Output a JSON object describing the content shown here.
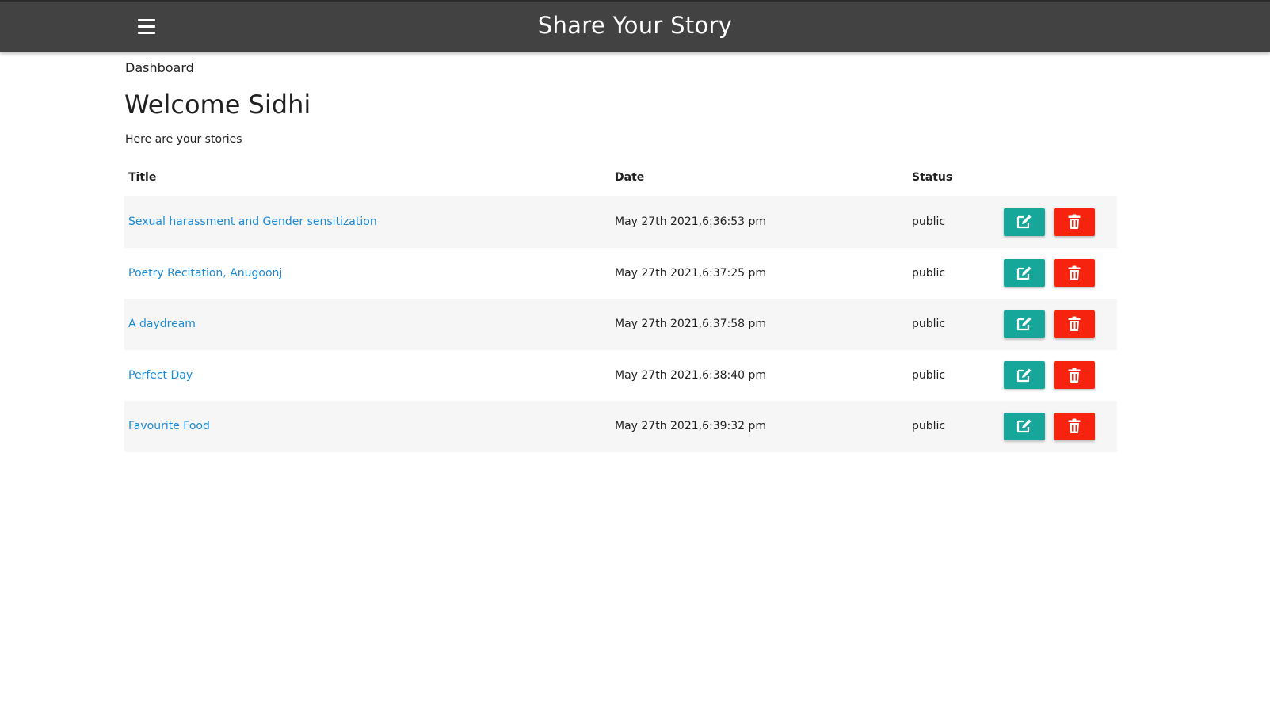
{
  "header": {
    "app_title": "Share Your Story",
    "menu_icon": "hamburger-menu-icon",
    "bar_color": "#424242"
  },
  "page": {
    "breadcrumb": "Dashboard",
    "welcome": "Welcome Sidhi",
    "subtitle": "Here are your stories"
  },
  "table": {
    "columns": [
      "Title",
      "Date",
      "Status"
    ],
    "rows": [
      {
        "title": "Sexual harassment and Gender sensitization",
        "date": "May 27th 2021,6:36:53 pm",
        "status": "public"
      },
      {
        "title": "Poetry Recitation, Anugoonj",
        "date": "May 27th 2021,6:37:25 pm",
        "status": "public"
      },
      {
        "title": "A daydream",
        "date": "May 27th 2021,6:37:58 pm",
        "status": "public"
      },
      {
        "title": "Perfect Day",
        "date": "May 27th 2021,6:38:40 pm",
        "status": "public"
      },
      {
        "title": "Favourite Food",
        "date": "May 27th 2021,6:39:32 pm",
        "status": "public"
      }
    ]
  },
  "colors": {
    "link": "#1a8ad4",
    "edit_button": "#16a79a",
    "delete_button": "#f6240f",
    "row_stripe": "#f6f6f6"
  },
  "icons": {
    "edit": "edit-icon",
    "delete": "trash-icon"
  }
}
